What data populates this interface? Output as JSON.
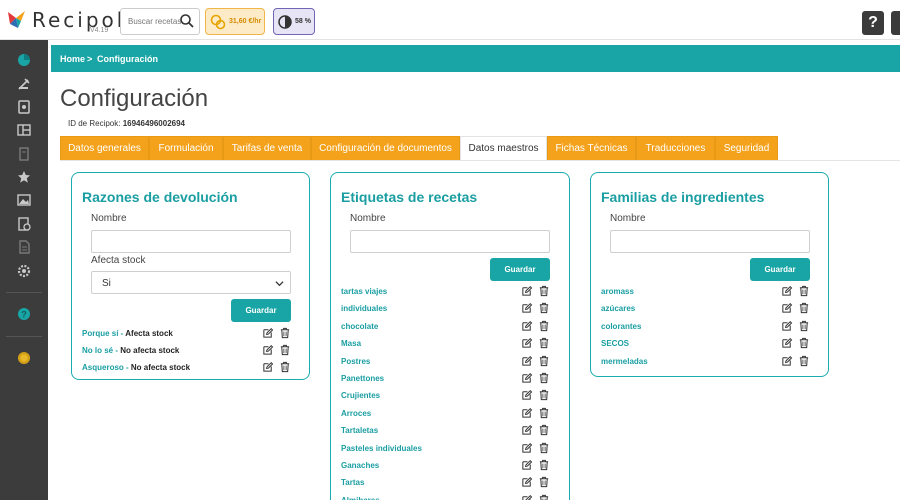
{
  "app": {
    "logo_text": "Recipok",
    "version": "V4.19",
    "search_placeholder": "Buscar recetas...",
    "cost_badge": "31,60 €/hr",
    "percent_badge": "58 %",
    "help_label": "?"
  },
  "colors": {
    "teal": "#19a5a5",
    "orange": "#f4a21b",
    "sidebar": "#3c3c3c"
  },
  "sidebar_icons": [
    "dashboard-icon",
    "recipes-icon",
    "ingredients-icon",
    "menu-icon",
    "book-icon",
    "star-icon",
    "image-icon",
    "document-icon",
    "file-icon",
    "settings-icon",
    "help-icon",
    "coin-icon"
  ],
  "breadcrumb": {
    "home": "Home",
    "separator": ">",
    "current": "Configuración"
  },
  "page": {
    "title": "Configuración",
    "id_label": "ID de Recipok:",
    "id_value": "16946496002694"
  },
  "tabs": [
    {
      "label": "Datos generales",
      "active": false
    },
    {
      "label": "Formulación",
      "active": false
    },
    {
      "label": "Tarifas de venta",
      "active": false
    },
    {
      "label": "Configuración de documentos",
      "active": false
    },
    {
      "label": "Datos maestros",
      "active": true
    },
    {
      "label": "Fichas Técnicas",
      "active": false
    },
    {
      "label": "Traducciones",
      "active": false
    },
    {
      "label": "Seguridad",
      "active": false
    }
  ],
  "razones": {
    "title": "Razones de devolución",
    "name_label": "Nombre",
    "name_value": "",
    "stock_label": "Afecta stock",
    "stock_value": "Si",
    "save_label": "Guardar",
    "items": [
      {
        "name": "Porque sí",
        "sep": " - ",
        "status": "Afecta stock"
      },
      {
        "name": "No lo sé",
        "sep": " - ",
        "status": "No afecta stock"
      },
      {
        "name": "Asqueroso",
        "sep": " - ",
        "status": "No afecta stock"
      }
    ]
  },
  "etiquetas": {
    "title": "Etiquetas de recetas",
    "name_label": "Nombre",
    "name_value": "",
    "save_label": "Guardar",
    "items": [
      "tartas viajes",
      "individuales",
      "chocolate",
      "Masa",
      "Postres",
      "Panettones",
      "Crujientes",
      "Arroces",
      "Tartaletas",
      "Pasteles individuales",
      "Ganaches",
      "Tartas",
      "Almibares"
    ]
  },
  "familias": {
    "title": "Familias de ingredientes",
    "name_label": "Nombre",
    "name_value": "",
    "save_label": "Guardar",
    "items": [
      "aromass",
      "azúcares",
      "colorantes",
      "SECOS",
      "mermeladas"
    ]
  }
}
